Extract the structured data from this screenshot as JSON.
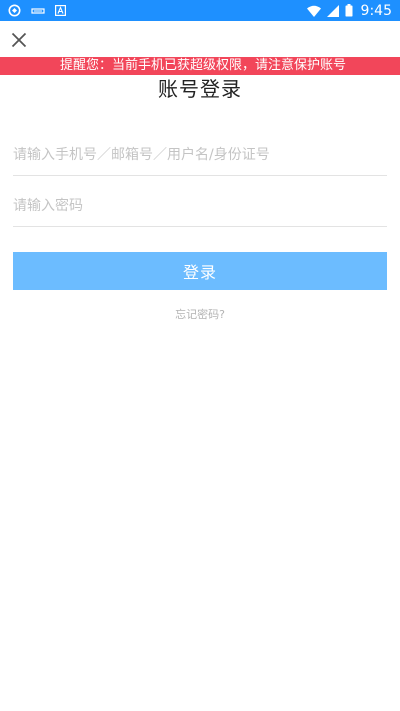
{
  "status_bar": {
    "time": "9:45",
    "background": "#1e90ff",
    "left_icons": [
      "app-notification-icon",
      "usb-icon",
      "font-a-icon"
    ],
    "right_icons": [
      "wifi-icon",
      "signal-icon",
      "battery-icon"
    ]
  },
  "close_icon": "close-icon",
  "banner": {
    "text": "提醒您：当前手机已获超级权限，请注意保护账号",
    "background": "#f2465a"
  },
  "title": "账号登录",
  "account": {
    "placeholder": "请输入手机号／邮箱号／用户名/身份证号",
    "value": ""
  },
  "password": {
    "placeholder": "请输入密码",
    "value": ""
  },
  "login_button": {
    "label": "登录",
    "background": "#6cbcff"
  },
  "forgot_password": "忘记密码?"
}
